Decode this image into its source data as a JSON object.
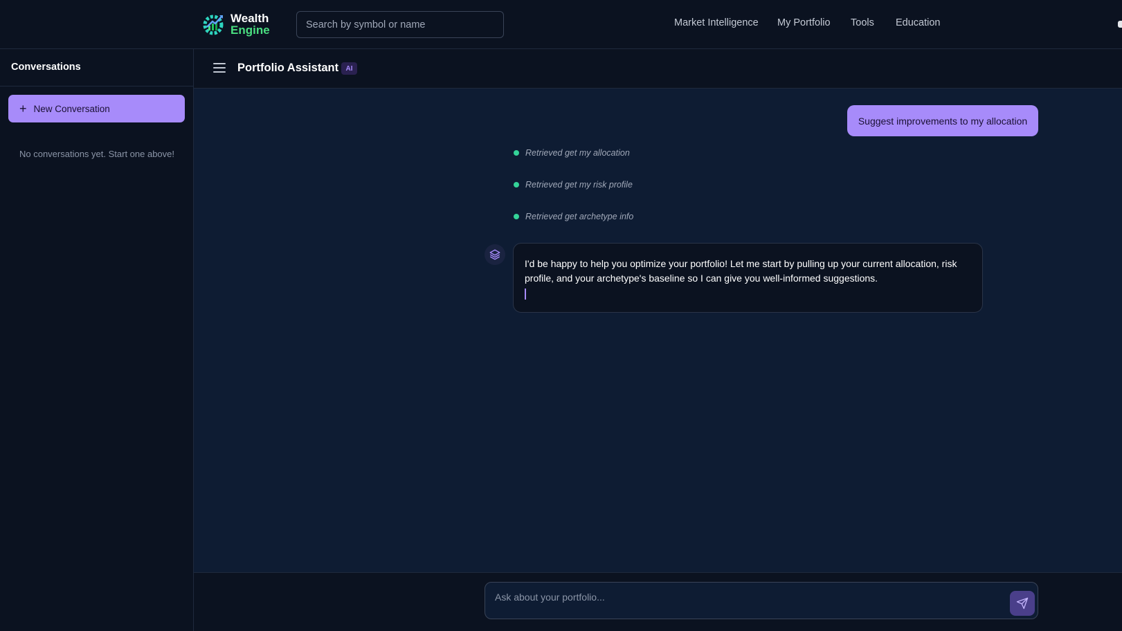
{
  "brand": {
    "line1": "Wealth",
    "line2": "Engine"
  },
  "search": {
    "placeholder": "Search by symbol or name"
  },
  "nav": {
    "items": [
      {
        "label": "Market Intelligence"
      },
      {
        "label": "My Portfolio"
      },
      {
        "label": "Tools"
      },
      {
        "label": "Education"
      }
    ]
  },
  "sidebar": {
    "title": "Conversations",
    "new_button_label": "New Conversation",
    "empty_text": "No conversations yet. Start one above!"
  },
  "main": {
    "title": "Portfolio Assistant",
    "badge": "AI"
  },
  "chat": {
    "user_message": "Suggest improvements to my allocation",
    "tool_calls": [
      {
        "text": "Retrieved get my allocation"
      },
      {
        "text": "Retrieved get my risk profile"
      },
      {
        "text": "Retrieved get archetype info"
      }
    ],
    "assistant_message": "I'd be happy to help you optimize your portfolio! Let me start by pulling up your current allocation, risk profile, and your archetype's baseline so I can give you well-informed suggestions."
  },
  "composer": {
    "placeholder": "Ask about your portfolio..."
  },
  "colors": {
    "accent": "#a78bfa",
    "success_dot": "#34d399",
    "brand_green": "#4ade80",
    "background": "#0b1220",
    "chat_background": "#0e1c33"
  },
  "icons": {
    "logo": "gear-chart-logo-icon",
    "new_conversation": "plus-icon",
    "menu": "hamburger-icon",
    "assistant": "layers-icon",
    "send": "send-icon"
  }
}
